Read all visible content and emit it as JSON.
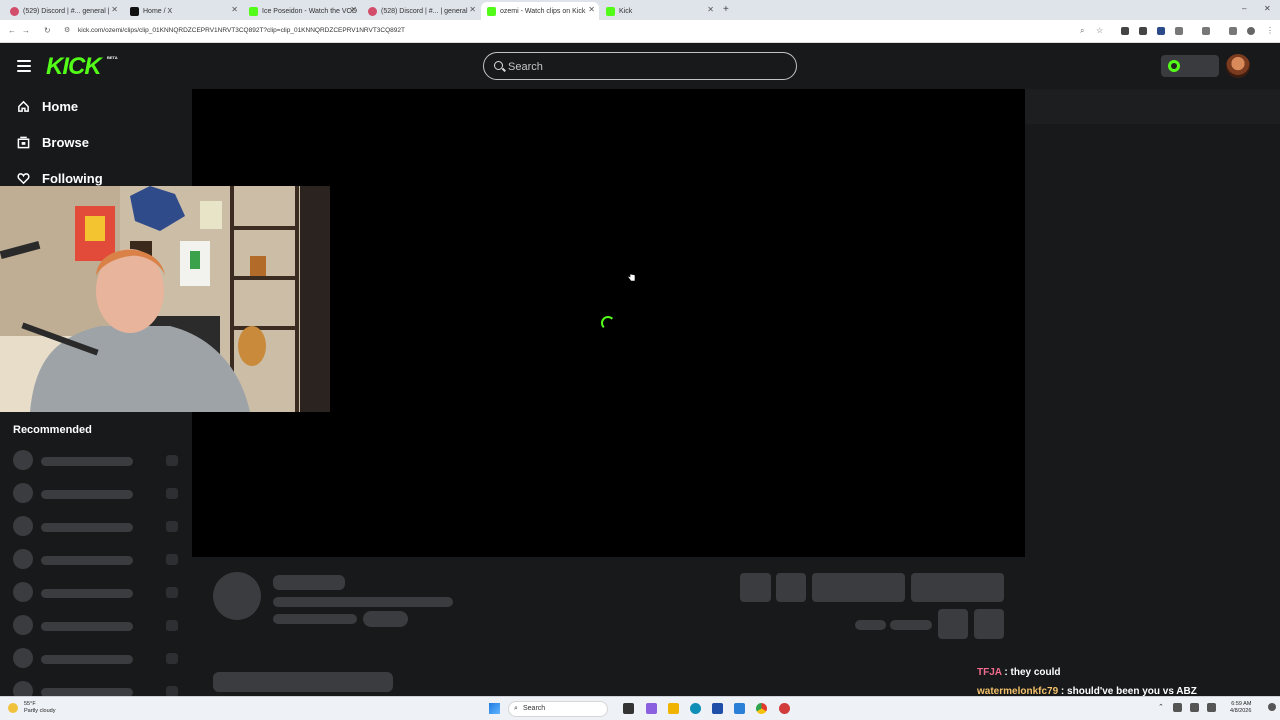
{
  "browser": {
    "tabs": [
      {
        "label": "(529) Discord | #... general |",
        "color": "#d24d6a"
      },
      {
        "label": "Home / X",
        "color": "#111111"
      },
      {
        "label": "Ice Poseidon - Watch the VOD",
        "color": "#53fc18"
      },
      {
        "label": "(528) Discord | #... | general",
        "color": "#d24d6a"
      },
      {
        "label": "ozemi - Watch clips on Kick",
        "color": "#53fc18"
      },
      {
        "label": "Kick",
        "color": "#53fc18"
      }
    ],
    "active_tab_index": 4,
    "new_tab_label": "+",
    "url": "kick.com/ozemi/clips/clip_01KNNQRDZCEPRV1NRVT3CQ892T?clip=clip_01KNNQRDZCEPRV1NRVT3CQ892T"
  },
  "header": {
    "logo": "KICK",
    "logo_badge": "BETA",
    "search_placeholder": "Search",
    "accent": "#53fc18"
  },
  "sidebar": {
    "nav": [
      {
        "label": "Home",
        "icon": "home-icon"
      },
      {
        "label": "Browse",
        "icon": "browse-icon"
      },
      {
        "label": "Following",
        "icon": "heart-icon"
      }
    ],
    "recommended_title": "Recommended"
  },
  "player": {
    "state": "loading"
  },
  "chat_overlay": [
    {
      "user": "TFJA",
      "user_color": "#f36b8e",
      "message": "they could"
    },
    {
      "user": "watermelonkfc79",
      "user_color": "#f4c26b",
      "message": "should've been you vs ABZ"
    }
  ],
  "taskbar": {
    "weather_temp": "55°F",
    "weather_desc": "Partly cloudy",
    "search_label": "Search",
    "time": "6:59 AM",
    "date": "4/8/2026"
  }
}
